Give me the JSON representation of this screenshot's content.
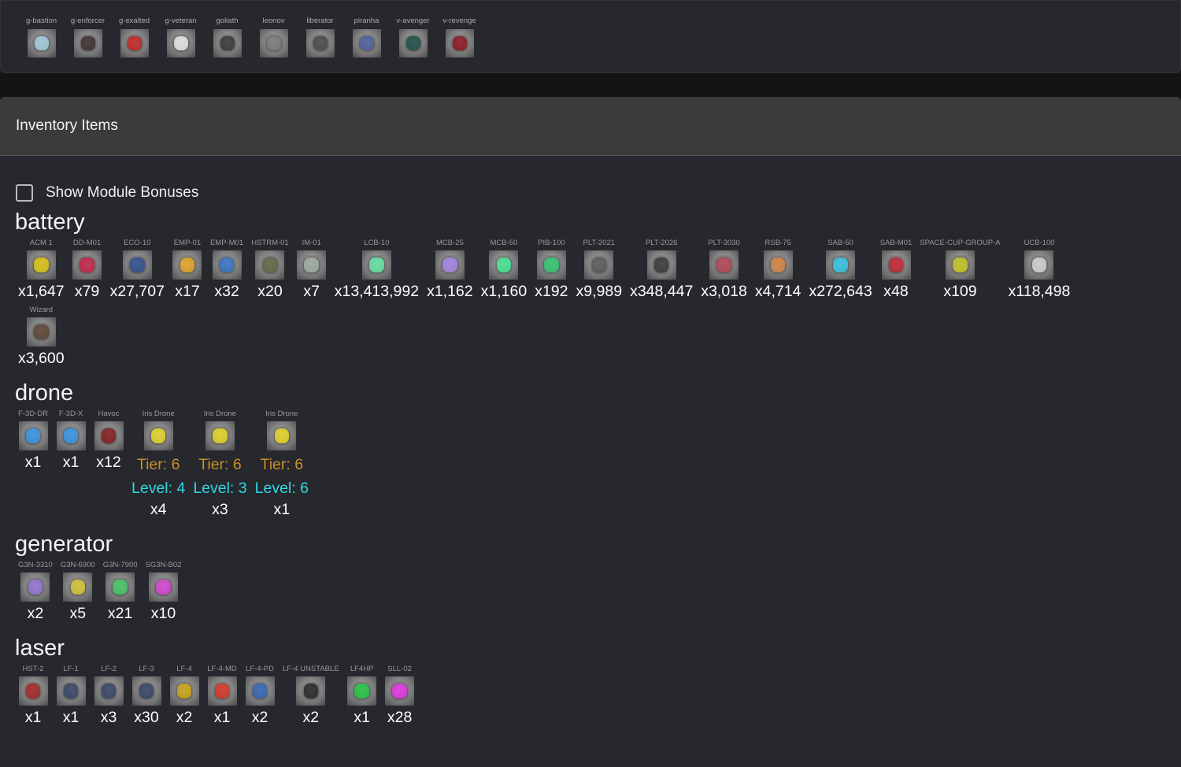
{
  "ships": [
    {
      "label": "g-bastion",
      "accent": "#9cc8d8"
    },
    {
      "label": "g-enforcer",
      "accent": "#3a2a2a"
    },
    {
      "label": "g-exalted",
      "accent": "#c02020"
    },
    {
      "label": "g-veteran",
      "accent": "#e0e0e0"
    },
    {
      "label": "goliath",
      "accent": "#333333"
    },
    {
      "label": "leonov",
      "accent": "#777777"
    },
    {
      "label": "liberator",
      "accent": "#444444"
    },
    {
      "label": "piranha",
      "accent": "#4a5a9a"
    },
    {
      "label": "v-avenger",
      "accent": "#1a4a44"
    },
    {
      "label": "v-revenge",
      "accent": "#8a1020"
    }
  ],
  "header": {
    "title": "Inventory Items"
  },
  "toggle": {
    "label": "Show Module Bonuses",
    "checked": false
  },
  "categories": [
    {
      "name": "battery",
      "items": [
        {
          "label": "ACM 1",
          "count": "x1,647",
          "accent": "#d8c010"
        },
        {
          "label": "DD-M01",
          "count": "x79",
          "accent": "#c02040"
        },
        {
          "label": "ECO-10",
          "count": "x27,707",
          "accent": "#2a4a8a"
        },
        {
          "label": "EMP-01",
          "count": "x17",
          "accent": "#e0a020"
        },
        {
          "label": "EMP-M01",
          "count": "x32",
          "accent": "#3070c0"
        },
        {
          "label": "HSTRM-01",
          "count": "x20",
          "accent": "#606040"
        },
        {
          "label": "IM-01",
          "count": "x7",
          "accent": "#9aa89a"
        },
        {
          "label": "LCB-10",
          "count": "x13,413,992",
          "accent": "#60e0a0"
        },
        {
          "label": "MCB-25",
          "count": "x1,162",
          "accent": "#a080e0"
        },
        {
          "label": "MCB-50",
          "count": "x1,160",
          "accent": "#40e090"
        },
        {
          "label": "PIB-100",
          "count": "x192",
          "accent": "#30c070"
        },
        {
          "label": "PLT-2021",
          "count": "x9,989",
          "accent": "#555555"
        },
        {
          "label": "PLT-2026",
          "count": "x348,447",
          "accent": "#333333"
        },
        {
          "label": "PLT-3030",
          "count": "x3,018",
          "accent": "#b04050"
        },
        {
          "label": "RSB-75",
          "count": "x4,714",
          "accent": "#d08040"
        },
        {
          "label": "SAB-50",
          "count": "x272,643",
          "accent": "#30c0e0"
        },
        {
          "label": "SAB-M01",
          "count": "x48",
          "accent": "#c02030"
        },
        {
          "label": "SPACE-CUP-GROUP-A",
          "count": "x109",
          "accent": "#c0c020"
        },
        {
          "label": "UCB-100",
          "count": "x118,498",
          "accent": "#cccccc"
        },
        {
          "label": "Wizard",
          "count": "x3,600",
          "accent": "#5a4030"
        }
      ]
    },
    {
      "name": "drone",
      "items": [
        {
          "label": "F-3D-DR",
          "count": "x1",
          "accent": "#3090e0"
        },
        {
          "label": "F-3D-X",
          "count": "x1",
          "accent": "#3090e0"
        },
        {
          "label": "Havoc",
          "count": "x12",
          "accent": "#801818"
        },
        {
          "label": "Iris Drone",
          "tier": "Tier: 6",
          "level": "Level: 4",
          "count": "x4",
          "accent": "#e0d020"
        },
        {
          "label": "Iris Drone",
          "tier": "Tier: 6",
          "level": "Level: 3",
          "count": "x3",
          "accent": "#e0d020"
        },
        {
          "label": "Iris Drone",
          "tier": "Tier: 6",
          "level": "Level: 6",
          "count": "x1",
          "accent": "#e0d020"
        }
      ]
    },
    {
      "name": "generator",
      "items": [
        {
          "label": "G3N-3310",
          "count": "x2",
          "accent": "#9070d0"
        },
        {
          "label": "G3N-6900",
          "count": "x5",
          "accent": "#d0c030"
        },
        {
          "label": "G3N-7900",
          "count": "x21",
          "accent": "#40c060"
        },
        {
          "label": "SG3N-B02",
          "count": "x10",
          "accent": "#d040d0"
        }
      ]
    },
    {
      "name": "laser",
      "items": [
        {
          "label": "HST-2",
          "count": "x1",
          "accent": "#a02020"
        },
        {
          "label": "LF-1",
          "count": "x1",
          "accent": "#304060"
        },
        {
          "label": "LF-2",
          "count": "x3",
          "accent": "#304060"
        },
        {
          "label": "LF-3",
          "count": "x30",
          "accent": "#304060"
        },
        {
          "label": "LF-4",
          "count": "x2",
          "accent": "#c8a010"
        },
        {
          "label": "LF-4-MD",
          "count": "x1",
          "accent": "#d03020"
        },
        {
          "label": "LF-4-PD",
          "count": "x2",
          "accent": "#3060b0"
        },
        {
          "label": "LF-4 UNSTABLE",
          "count": "x2",
          "accent": "#222222"
        },
        {
          "label": "LF4HP",
          "count": "x1",
          "accent": "#20c040"
        },
        {
          "label": "SLL-02",
          "count": "x28",
          "accent": "#e030e0"
        }
      ]
    }
  ]
}
